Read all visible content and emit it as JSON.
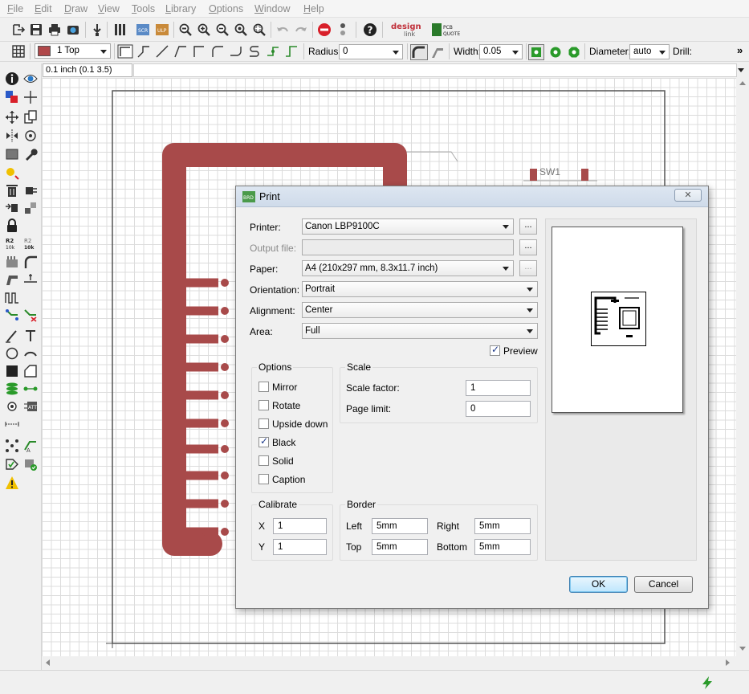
{
  "menu": [
    "File",
    "Edit",
    "Draw",
    "View",
    "Tools",
    "Library",
    "Options",
    "Window",
    "Help"
  ],
  "toolbar2": {
    "layer_value": "1 Top",
    "layer_color": "#b0484a",
    "radius_label": "Radius:",
    "radius_value": "0",
    "width_label": "Width:",
    "width_value": "0.05",
    "diameter_label": "Diameter:",
    "diameter_value": "auto",
    "drill_label": "Drill:",
    "overflow": "»"
  },
  "coord_readout": "0.1 inch (0.1 3.5)",
  "canvas": {
    "pcb_label_sw1": "SW1",
    "trace_color": "#a84a4a"
  },
  "dialog": {
    "title": "Print",
    "printer_label": "Printer:",
    "printer_value": "Canon LBP9100C",
    "output_label": "Output file:",
    "output_value": "",
    "paper_label": "Paper:",
    "paper_value": "A4 (210x297 mm, 8.3x11.7 inch)",
    "orientation_label": "Orientation:",
    "orientation_value": "Portrait",
    "alignment_label": "Alignment:",
    "alignment_value": "Center",
    "area_label": "Area:",
    "area_value": "Full",
    "preview_label": "Preview",
    "preview_checked": true,
    "ellipsis": "...",
    "options_title": "Options",
    "options": [
      {
        "label": "Mirror",
        "checked": false
      },
      {
        "label": "Rotate",
        "checked": false
      },
      {
        "label": "Upside down",
        "checked": false
      },
      {
        "label": "Black",
        "checked": true
      },
      {
        "label": "Solid",
        "checked": false
      },
      {
        "label": "Caption",
        "checked": false
      }
    ],
    "scale_title": "Scale",
    "scale_factor_label": "Scale factor:",
    "scale_factor_value": "1",
    "page_limit_label": "Page limit:",
    "page_limit_value": "0",
    "calibrate_title": "Calibrate",
    "cal_x_label": "X",
    "cal_x_value": "1",
    "cal_y_label": "Y",
    "cal_y_value": "1",
    "border_title": "Border",
    "left_label": "Left",
    "left_value": "5mm",
    "right_label": "Right",
    "right_value": "5mm",
    "top_label": "Top",
    "top_value": "5mm",
    "bottom_label": "Bottom",
    "bottom_value": "5mm",
    "ok_label": "OK",
    "cancel_label": "Cancel",
    "close_glyph": "✕"
  }
}
